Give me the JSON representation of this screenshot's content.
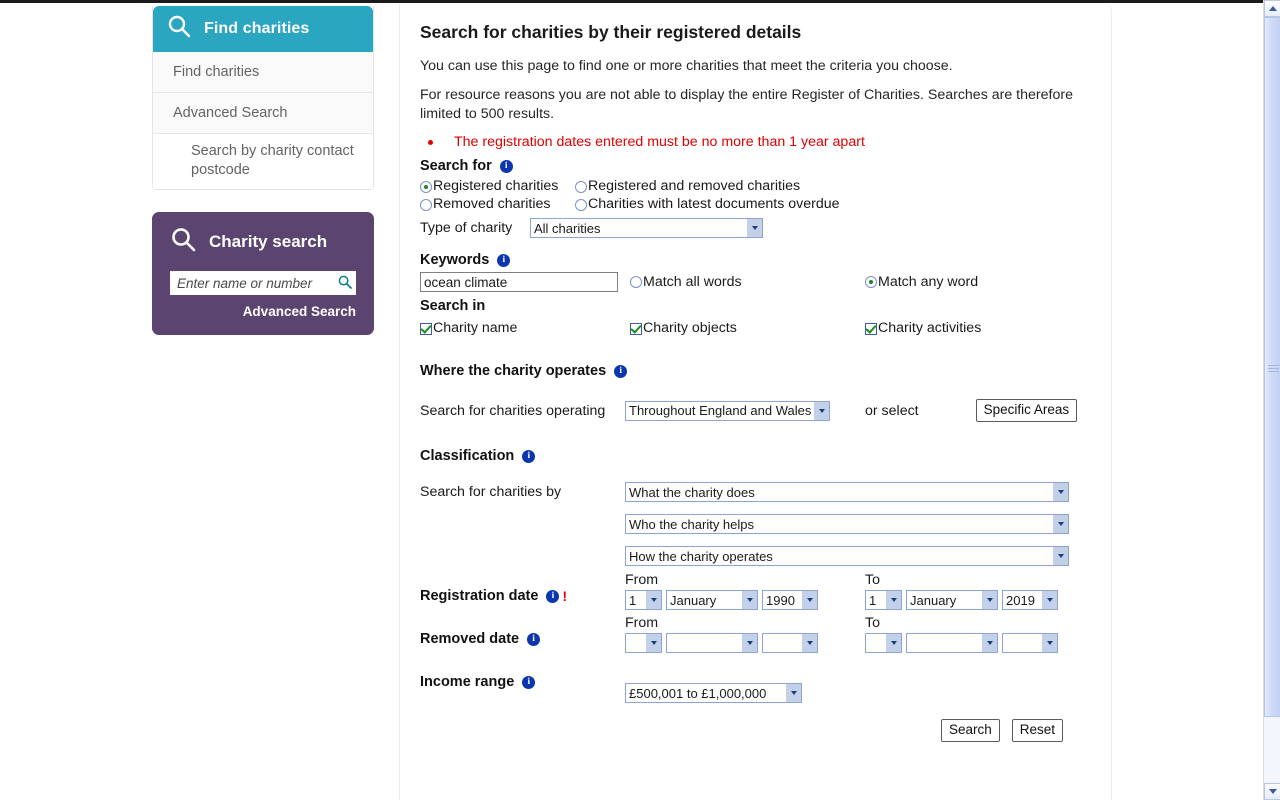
{
  "sidebar": {
    "nav": {
      "header_title": "Find charities",
      "header_icon": "magnifier-icon",
      "items": [
        {
          "label": "Find charities"
        },
        {
          "label": "Advanced Search"
        },
        {
          "label": "Search by charity contact postcode"
        }
      ]
    },
    "charity_search": {
      "header_title": "Charity search",
      "header_icon": "magnifier-icon",
      "input_placeholder": "Enter name or number",
      "input_value": "",
      "go_icon": "search-icon",
      "advanced_link": "Advanced Search"
    }
  },
  "main": {
    "page_title": "Search for charities by their registered details",
    "intro_1": "You can use this page to find one or more charities that meet the criteria you choose.",
    "intro_2": "For resource reasons you are not able to display the entire Register of Charities. Searches are therefore limited to 500 results.",
    "errors": [
      "The registration dates entered must be no more than 1 year apart"
    ],
    "search_for": {
      "heading": "Search for",
      "info_icon": "info-icon",
      "options": [
        {
          "label": "Registered charities",
          "selected": true
        },
        {
          "label": "Registered and removed charities",
          "selected": false
        },
        {
          "label": "Removed charities",
          "selected": false
        },
        {
          "label": "Charities with latest documents overdue",
          "selected": false
        }
      ],
      "type_label": "Type of charity",
      "type_value": "All charities"
    },
    "keywords": {
      "heading": "Keywords",
      "info_icon": "info-icon",
      "value": "ocean climate",
      "match_all_label": "Match all words",
      "match_all_selected": false,
      "match_any_label": "Match any word",
      "match_any_selected": true
    },
    "search_in": {
      "heading": "Search in",
      "options": [
        {
          "label": "Charity name",
          "checked": true
        },
        {
          "label": "Charity objects",
          "checked": true
        },
        {
          "label": "Charity activities",
          "checked": true
        }
      ]
    },
    "where_operates": {
      "heading": "Where the charity operates",
      "info_icon": "info-icon",
      "label": "Search for charities operating",
      "value": "Throughout England and Wales",
      "or_select": "or select",
      "specific_areas_button": "Specific Areas"
    },
    "classification": {
      "heading": "Classification",
      "info_icon": "info-icon",
      "label": "Search for charities by",
      "selects": [
        {
          "value": "What the charity does"
        },
        {
          "value": "Who the charity helps"
        },
        {
          "value": "How the charity operates"
        }
      ]
    },
    "registration_date": {
      "heading": "Registration date",
      "info_icon": "info-icon",
      "error_marker": "!",
      "from_label": "From",
      "from_day": "1",
      "from_month": "January",
      "from_year": "1990",
      "to_label": "To",
      "to_day": "1",
      "to_month": "January",
      "to_year": "2019"
    },
    "removed_date": {
      "heading": "Removed date",
      "info_icon": "info-icon",
      "from_label": "From",
      "from_day": "",
      "from_month": "",
      "from_year": "",
      "to_label": "To",
      "to_day": "",
      "to_month": "",
      "to_year": ""
    },
    "income_range": {
      "heading": "Income range",
      "info_icon": "info-icon",
      "value": "£500,001 to £1,000,000"
    },
    "actions": {
      "search_button": "Search",
      "reset_button": "Reset"
    }
  },
  "scrollbar": {
    "up_icon": "chevron-up-icon",
    "down_icon": "chevron-down-icon"
  }
}
